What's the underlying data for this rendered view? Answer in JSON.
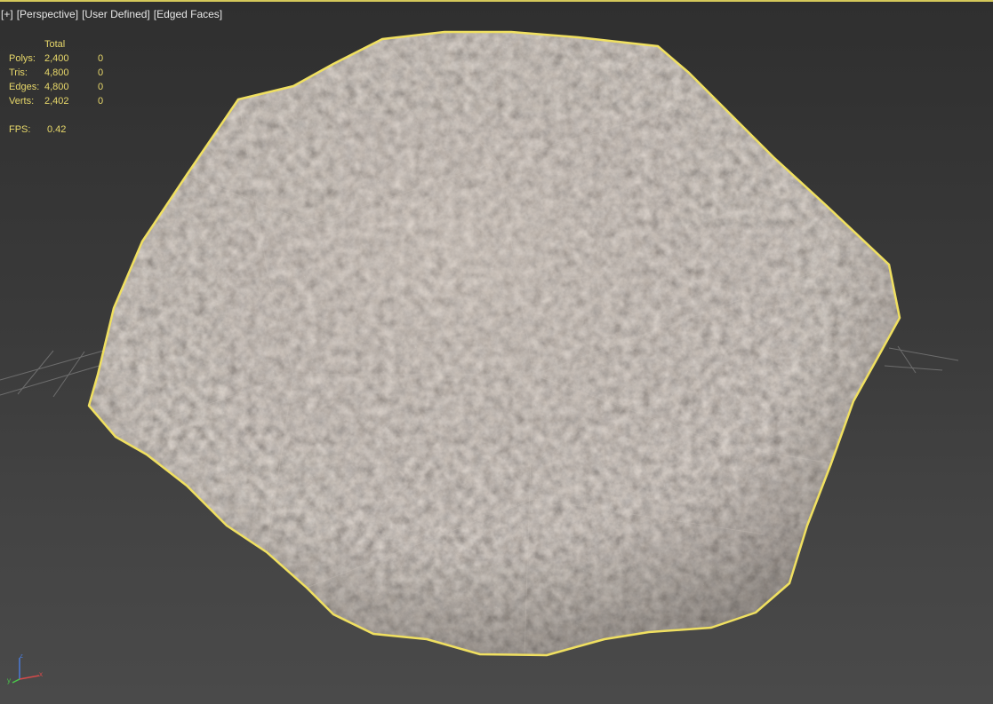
{
  "viewport": {
    "labels": [
      "[+]",
      "[Perspective]",
      "[User Defined]",
      "[Edged Faces]"
    ]
  },
  "stats": {
    "header": "Total",
    "rows": [
      {
        "label": "Polys:",
        "total": "2,400",
        "selected": "0"
      },
      {
        "label": "Tris:",
        "total": "4,800",
        "selected": "0"
      },
      {
        "label": "Edges:",
        "total": "4,800",
        "selected": "0"
      },
      {
        "label": "Verts:",
        "total": "2,402",
        "selected": "0"
      }
    ],
    "fps_label": "FPS:",
    "fps_value": "0.42"
  },
  "colors": {
    "selection_outline": "#f0e060",
    "grid": "#7a7a7a",
    "stats_text": "#e8d86a"
  },
  "gizmo": {
    "x_axis": "x",
    "y_axis": "y",
    "z_axis": "z"
  }
}
